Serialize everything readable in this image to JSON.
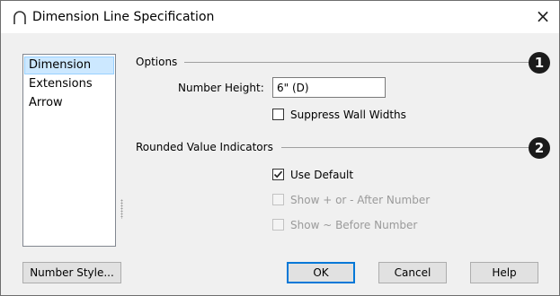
{
  "window": {
    "title": "Dimension Line Specification",
    "close_glyph": "×",
    "icon": "arch-icon"
  },
  "sidebar": {
    "items": [
      {
        "label": "Dimension",
        "selected": true
      },
      {
        "label": "Extensions",
        "selected": false
      },
      {
        "label": "Arrow",
        "selected": false
      }
    ]
  },
  "options": {
    "title": "Options",
    "marker": "1",
    "number_height_label": "Number Height:",
    "number_height_value": "6\" (D)",
    "suppress_wall_widths": {
      "label": "Suppress Wall Widths",
      "checked": false,
      "enabled": true
    }
  },
  "rounded": {
    "title": "Rounded Value Indicators",
    "marker": "2",
    "use_default": {
      "label": "Use Default",
      "checked": true,
      "enabled": true
    },
    "show_plus_minus": {
      "label": "Show + or - After Number",
      "checked": false,
      "enabled": false
    },
    "show_tilde": {
      "label": "Show ~ Before Number",
      "checked": false,
      "enabled": false
    }
  },
  "buttons": {
    "number_style": "Number Style...",
    "ok": "OK",
    "cancel": "Cancel",
    "help": "Help"
  },
  "colors": {
    "selection": "#cce8ff",
    "default_button_border": "#0078d7",
    "dialog_bg": "#f0f0f0"
  }
}
